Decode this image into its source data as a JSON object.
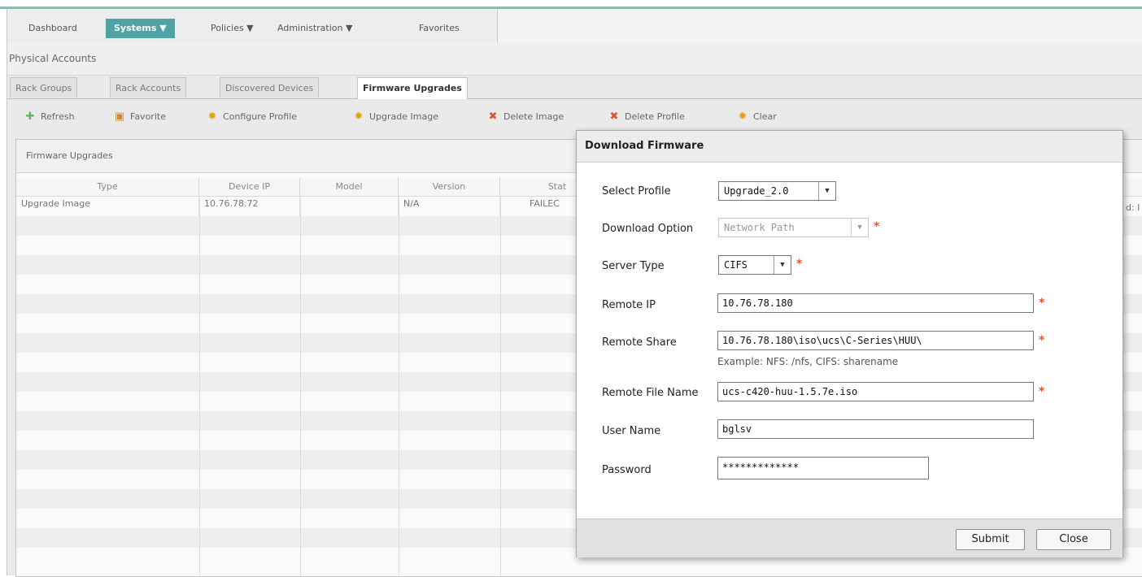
{
  "menubar": {
    "items": [
      {
        "label": "Dashboard"
      },
      {
        "label": "Systems ▼"
      },
      {
        "label": "Policies ▼"
      },
      {
        "label": "Administration ▼"
      },
      {
        "label": "Favorites"
      }
    ]
  },
  "breadcrumb": "Physical Accounts",
  "tabs": [
    {
      "label": "Rack Groups"
    },
    {
      "label": "Rack Accounts"
    },
    {
      "label": "Discovered Devices"
    },
    {
      "label": "Firmware Upgrades"
    }
  ],
  "toolbar": {
    "refresh": "Refresh",
    "favorite": "Favorite",
    "configure_profile": "Configure Profile",
    "upgrade_image": "Upgrade Image",
    "delete_image": "Delete Image",
    "delete_profile": "Delete Profile",
    "clear": "Clear"
  },
  "panel": {
    "title": "Firmware Upgrades",
    "columns": [
      "Type",
      "Device IP",
      "Model",
      "Version",
      "Stat"
    ],
    "rows": [
      {
        "type": "Upgrade Image",
        "device_ip": "10.76.78.72",
        "model": "",
        "version": "N/A",
        "status": "FAILEC"
      }
    ],
    "right_cut_text": "d: I"
  },
  "dialog": {
    "title": "Download Firmware",
    "select_profile": {
      "label": "Select Profile",
      "value": "Upgrade_2.0"
    },
    "download_option": {
      "label": "Download Option",
      "value": "Network Path"
    },
    "server_type": {
      "label": "Server Type",
      "value": "CIFS"
    },
    "remote_ip": {
      "label": "Remote IP",
      "value": "10.76.78.180"
    },
    "remote_share": {
      "label": "Remote Share",
      "value": "10.76.78.180\\iso\\ucs\\C-Series\\HUU\\",
      "hint": "Example: NFS: /nfs, CIFS: sharename"
    },
    "remote_file_name": {
      "label": "Remote File Name",
      "value": "ucs-c420-huu-1.5.7e.iso"
    },
    "user_name": {
      "label": "User Name",
      "value": "bglsv"
    },
    "password": {
      "label": "Password",
      "value": "*************"
    },
    "required_marker": "*",
    "submit": "Submit",
    "close": "Close"
  },
  "colors": {
    "accent": "#4fa3a5",
    "required": "#e4572e"
  }
}
